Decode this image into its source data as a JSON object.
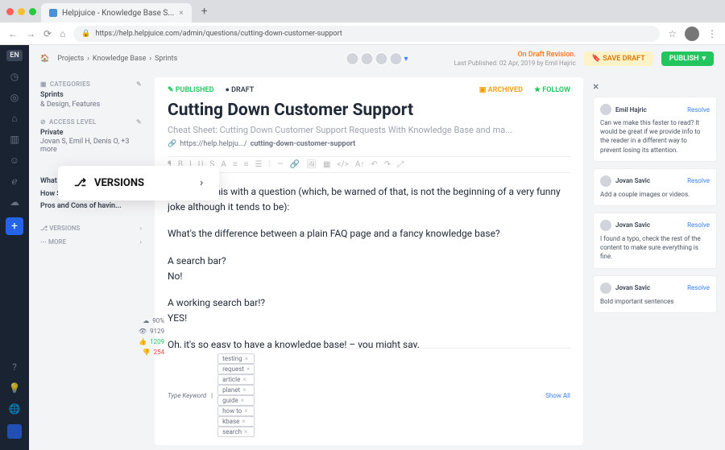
{
  "browser": {
    "tab_title": "Helpjuice - Knowledge Base S...",
    "url": "https://help.helpjuice.com/admin/questions/cutting-down-customer-support"
  },
  "rail": {
    "lang": "EN"
  },
  "topbar": {
    "home_icon": "⌂",
    "crumb1": "Projects",
    "crumb2": "Knowledge Base",
    "crumb3": "Sprints",
    "revision": "On Draft Revision.",
    "last_published": "Last Published: 02 Apr, 2019 by Emil Hajric",
    "save_draft": "SAVE DRAFT",
    "publish": "PUBLISH"
  },
  "sidebar": {
    "categories_head": "CATEGORIES",
    "categories_main": "Sprints",
    "categories_sub": "& Design, Features",
    "access_head": "ACCESS LEVEL",
    "access_main": "Private",
    "access_sub": "Jovan S, Emil H, Denis O, +3 more",
    "rel1": "What are advantages of...",
    "rel2": "How Simple Knowledge...",
    "rel3": "Pros and Cons of havin...",
    "versions": "VERSIONS",
    "more": "MORE"
  },
  "versions_popup": "VERSIONS",
  "stats": {
    "views": "90%",
    "likes": "9129",
    "up": "1209",
    "down": "254"
  },
  "editor": {
    "published": "PUBLISHED",
    "draft": "DRAFT",
    "archived": "ARCHIVED",
    "follow": "FOLLOW",
    "title": "Cutting Down Customer Support",
    "subtitle": "Cheat Sheet: Cutting Down Customer Support Requests With Knowledge Base and ma...",
    "slug_prefix": "https://help.helpju.../",
    "slug": "cutting-down-customer-support",
    "p1": "Let's start this with a question (which, be warned of that, is not the beginning of a very funny joke although it tends to be):",
    "p2": "What's the difference between a plain FAQ page and a fancy knowledge base?",
    "p3a": "A search bar?",
    "p3b": "No!",
    "p4a": "A working search bar!?",
    "p4b": "YES!",
    "p5": "Oh, it's so easy to have a knowledge base! – you might say.",
    "tag_input": "Type Keyword",
    "tags": [
      "testing",
      "request",
      "article",
      "planet",
      "guide",
      "how to",
      "kbase",
      "search"
    ],
    "show_all": "Show All"
  },
  "comments": [
    {
      "name": "Emil Hajric",
      "body": "Can we make this faster to read? It would be great if we provide info to the reader in a different way to prevent losing its attention."
    },
    {
      "name": "Jovan Savic",
      "body": "Add a couple images or videos."
    },
    {
      "name": "Jovan Savic",
      "body": "I found a typo, check the rest of the content to make sure everything is fine."
    },
    {
      "name": "Jovan Savic",
      "body": "Bold important sentences"
    }
  ],
  "resolve": "Resolve"
}
